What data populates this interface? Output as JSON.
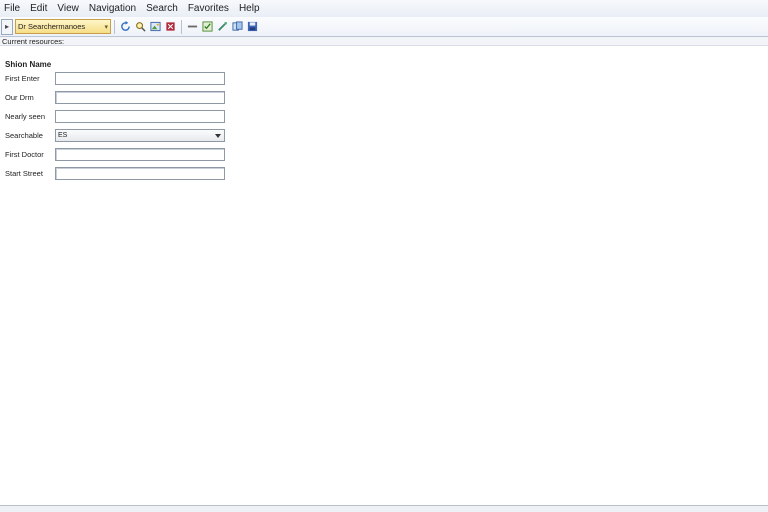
{
  "menu": {
    "items": [
      "File",
      "Edit",
      "View",
      "Navigation",
      "Search",
      "Favorites",
      "Help"
    ]
  },
  "toolbar": {
    "left_button_label": "▸",
    "combo_value": "Dr Searchermanoes",
    "icons": [
      "refresh-icon",
      "search-icon",
      "picture-icon",
      "stop-icon",
      "add-icon",
      "save-icon",
      "favorite-icon",
      "link-icon",
      "disk-icon"
    ]
  },
  "strip": {
    "text": "Current resources:"
  },
  "form": {
    "title": "Shion Name",
    "fields": [
      {
        "label": "First Enter",
        "value": "",
        "type": "text"
      },
      {
        "label": "Our Drm",
        "value": "",
        "type": "text-cursor"
      },
      {
        "label": "Nearly seen",
        "value": "",
        "type": "text"
      },
      {
        "label": "Searchable",
        "value": "ES",
        "type": "select"
      },
      {
        "label": "First Doctor",
        "value": "",
        "type": "text-cursor"
      },
      {
        "label": "Start Street",
        "value": "",
        "type": "text-cursor"
      }
    ]
  },
  "colors": {
    "accent_combo": "#f6dd86",
    "toolbar_bg": "#eef2f8",
    "border": "#8f99a6"
  }
}
